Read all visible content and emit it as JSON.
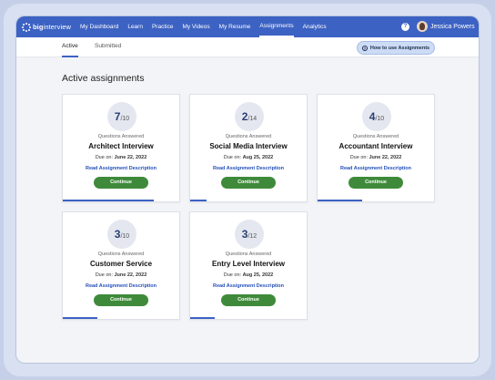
{
  "nav": {
    "brand_bold": "big",
    "brand_rest": "interview",
    "items": [
      "My Dashboard",
      "Learn",
      "Practice",
      "My Videos",
      "My Resume",
      "Assignments",
      "Analytics"
    ],
    "active_index": 5,
    "help": "?",
    "user_name": "Jessica Powers"
  },
  "subnav": {
    "tabs": [
      "Active",
      "Submitted"
    ],
    "active_index": 0,
    "how_button": "How to use Assignments",
    "how_icon": "?"
  },
  "main": {
    "heading": "Active assignments",
    "questions_label": "Questions Answered",
    "due_prefix": "Due on:",
    "read_label": "Read Assignment Description",
    "continue_label": "Continue",
    "cards": [
      {
        "answered": "7",
        "total": "/10",
        "title": "Architect Interview",
        "due": "June 22, 2022",
        "progress": 0.78
      },
      {
        "answered": "2",
        "total": "/14",
        "title": "Social Media Interview",
        "due": "Aug 25, 2022",
        "progress": 0.14
      },
      {
        "answered": "4",
        "total": "/10",
        "title": "Accountant Interview",
        "due": "June 22, 2022",
        "progress": 0.38
      },
      {
        "answered": "3",
        "total": "/10",
        "title": "Customer Service",
        "due": "June 22, 2022",
        "progress": 0.3
      },
      {
        "answered": "3",
        "total": "/12",
        "title": "Entry Level Interview",
        "due": "Aug 25, 2022",
        "progress": 0.21
      }
    ]
  },
  "colors": {
    "nav_bg": "#3c62c3",
    "button_green": "#3f8a3a",
    "link_blue": "#2450b8"
  }
}
